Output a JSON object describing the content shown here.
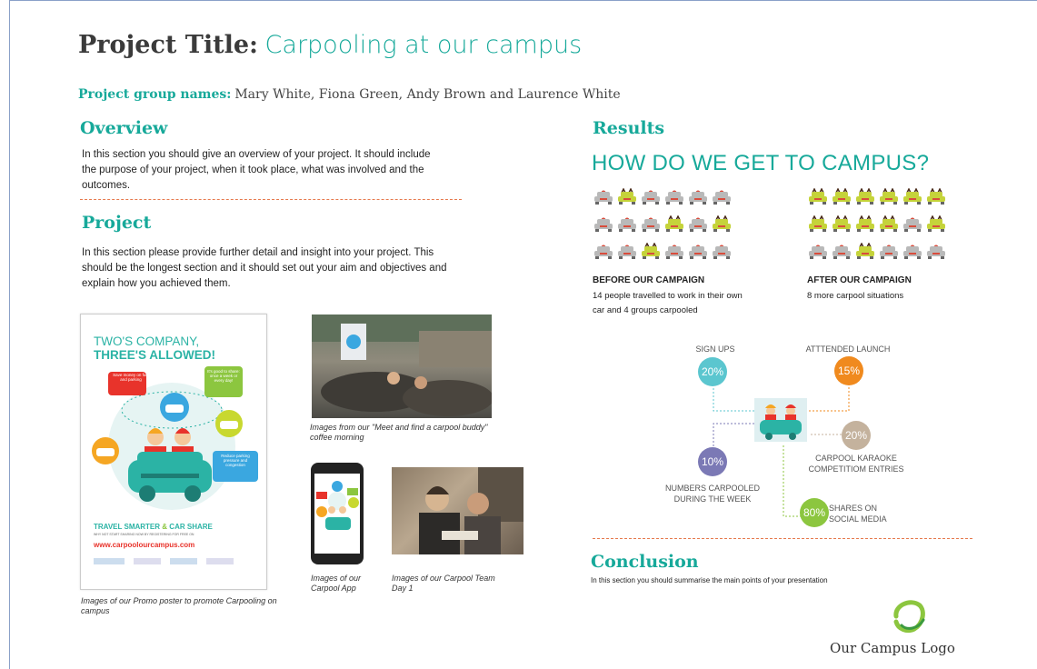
{
  "header": {
    "title_label": "Project Title:",
    "title_value": "Carpooling at our campus",
    "names_label": "Project group names:",
    "names_value": "Mary White, Fiona Green, Andy Brown and Laurence White"
  },
  "overview": {
    "heading": "Overview",
    "text": "In this section you should give an overview of your project. It should include the purpose of your project, when it took place, what was involved and the outcomes."
  },
  "project": {
    "heading": "Project",
    "text": "In this section please provide further detail and insight into your project. This should be the longest section and it should set out your aim and objectives and explain how you achieved them."
  },
  "poster": {
    "line1": "TWO'S COMPANY,",
    "line2": "THREE'S ALLOWED!",
    "bubble1": "Save money on fuel and parking",
    "bubble2": "It's good to share: once a week or every day!",
    "bubble3": "Reduce parking pressure and congestion",
    "tagline1": "TRAVEL SMARTER",
    "tagline_amp": "&",
    "tagline2": "CAR SHARE",
    "small": "WHY NOT START SHARING NOW BY REGISTERING FOR FREE ON",
    "url": "www.carpoolourcampus.com"
  },
  "captions": {
    "poster": "Images of our Promo poster to promote Carpooling on campus",
    "coffee": "Images from our \"Meet and find a carpool buddy\" coffee morning",
    "app": "Images of our Carpool App",
    "team": "Images of our Carpool Team Day 1"
  },
  "results": {
    "heading": "Results",
    "subheading": "HOW DO WE GET TO CAMPUS?",
    "before_title": "BEFORE OUR CAMPAIGN",
    "before_text": "14 people travelled to work in their own car and 4 groups carpooled",
    "after_title": "AFTER OUR CAMPAIGN",
    "after_text": "8 more carpool situations",
    "before_cars": [
      0,
      1,
      0,
      0,
      0,
      0,
      0,
      0,
      0,
      1,
      0,
      1,
      0,
      0,
      1,
      0,
      0,
      0
    ],
    "after_cars": [
      1,
      1,
      1,
      1,
      1,
      1,
      1,
      1,
      1,
      1,
      0,
      1,
      0,
      0,
      1,
      0,
      0,
      0
    ],
    "colors": {
      "grey": "#b9b9b9",
      "green": "#c5d33a",
      "red": "#d84c3c"
    }
  },
  "stats": [
    {
      "label": "SIGN UPS",
      "value": "20%",
      "color": "#5bc6cf"
    },
    {
      "label": "ATTTENDED LAUNCH",
      "value": "15%",
      "color": "#f08a1e"
    },
    {
      "label": "CARPOOL KARAOKE COMPETITIOM ENTRIES",
      "value": "20%",
      "color": "#c4b29d"
    },
    {
      "label": "NUMBERS CARPOOLED DURING THE WEEK",
      "value": "10%",
      "color": "#7b79b5"
    },
    {
      "label": "SHARES ON SOCIAL MEDIA",
      "value": "80%",
      "color": "#8cc63f"
    }
  ],
  "conclusion": {
    "heading": "Conclusion",
    "text": "In this section you should summarise the main points of your presentation"
  },
  "logo": {
    "text": "Our Campus Logo"
  }
}
